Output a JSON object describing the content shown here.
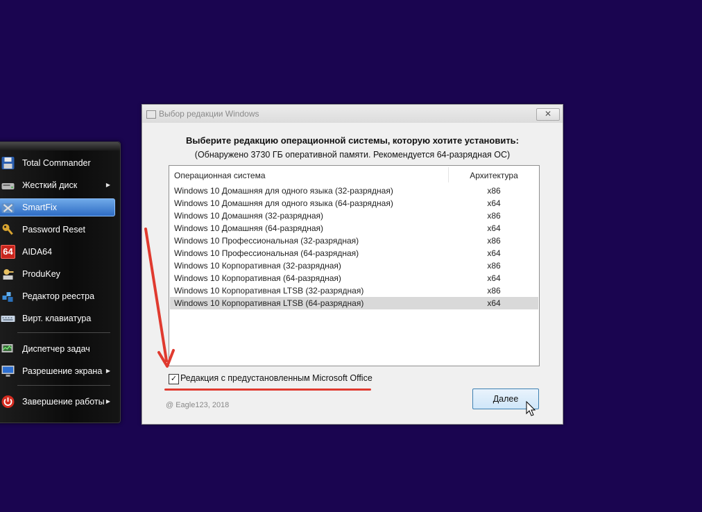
{
  "launcher": {
    "items": [
      {
        "label": "Total Commander",
        "icon": "floppy-disk-icon",
        "submenu": false
      },
      {
        "label": "Жесткий диск",
        "icon": "hard-disk-icon",
        "submenu": true
      },
      {
        "label": "SmartFix",
        "icon": "smartfix-icon",
        "submenu": false,
        "active": true
      },
      {
        "label": "Password Reset",
        "icon": "key-icon",
        "submenu": false
      },
      {
        "label": "AIDA64",
        "icon": "aida64-icon",
        "icon_text": "64",
        "submenu": false
      },
      {
        "label": "ProduKey",
        "icon": "produkey-icon",
        "submenu": false
      },
      {
        "label": "Редактор реестра",
        "icon": "registry-icon",
        "submenu": false
      },
      {
        "label": "Вирт. клавиатура",
        "icon": "keyboard-icon",
        "submenu": false
      },
      {
        "label": "Диспетчер задач",
        "icon": "task-manager-icon",
        "submenu": false
      },
      {
        "label": "Разрешение экрана",
        "icon": "monitor-icon",
        "submenu": true
      },
      {
        "label": "Завершение работы",
        "icon": "power-icon",
        "submenu": true
      }
    ]
  },
  "dialog": {
    "title": "Выбор редакции Windows",
    "close_label": "✕",
    "heading": "Выберите редакцию операционной системы, которую хотите установить:",
    "subheading": "(Обнаружено 3730 ГБ оперативной памяти. Рекомендуется 64-разрядная ОС)",
    "columns": {
      "os": "Операционная система",
      "arch": "Архитектура"
    },
    "rows": [
      {
        "os": "Windows 10 Домашняя для одного языка (32-разрядная)",
        "arch": "x86"
      },
      {
        "os": "Windows 10 Домашняя для одного языка (64-разрядная)",
        "arch": "x64"
      },
      {
        "os": "Windows 10 Домашняя (32-разрядная)",
        "arch": "x86"
      },
      {
        "os": "Windows 10 Домашняя (64-разрядная)",
        "arch": "x64"
      },
      {
        "os": "Windows 10 Профессиональная (32-разрядная)",
        "arch": "x86"
      },
      {
        "os": "Windows 10 Профессиональная (64-разрядная)",
        "arch": "x64"
      },
      {
        "os": "Windows 10 Корпоративная (32-разрядная)",
        "arch": "x86"
      },
      {
        "os": "Windows 10 Корпоративная (64-разрядная)",
        "arch": "x64"
      },
      {
        "os": "Windows 10 Корпоративная LTSB (32-разрядная)",
        "arch": "x86"
      },
      {
        "os": "Windows 10 Корпоративная LTSB (64-разрядная)",
        "arch": "x64"
      }
    ],
    "selected_row": 9,
    "office_checkbox": {
      "label": "Редакция с предустановленным Microsoft Office",
      "checked": true,
      "mark": "✓"
    },
    "copyright": "@ Eagle123, 2018",
    "next_label": "Далее"
  },
  "colors": {
    "desktop": "#1a0550",
    "accent_red": "#e03a2f",
    "selection": "#d9d9d9",
    "menu_active": "#3c7ed4"
  }
}
